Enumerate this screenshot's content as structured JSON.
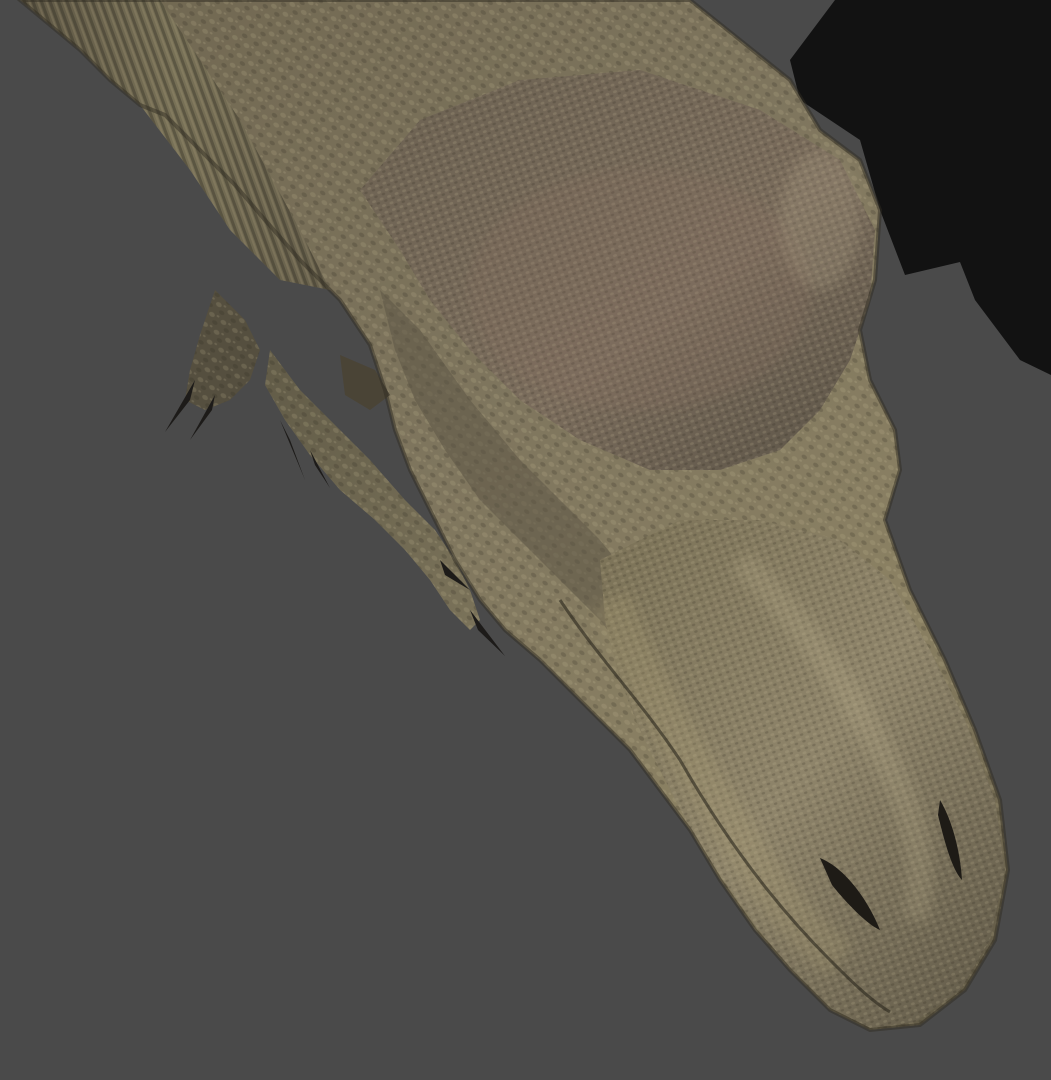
{
  "scene": {
    "subject": "dinosaur-model",
    "background_color": "#4a4a4a",
    "shadow_color": "#121212",
    "skin_base_color": "#7a7158",
    "skin_highlight_color": "#b9ad88",
    "skin_shadow_color": "#3b3629",
    "claw_color": "#1d1b19"
  }
}
